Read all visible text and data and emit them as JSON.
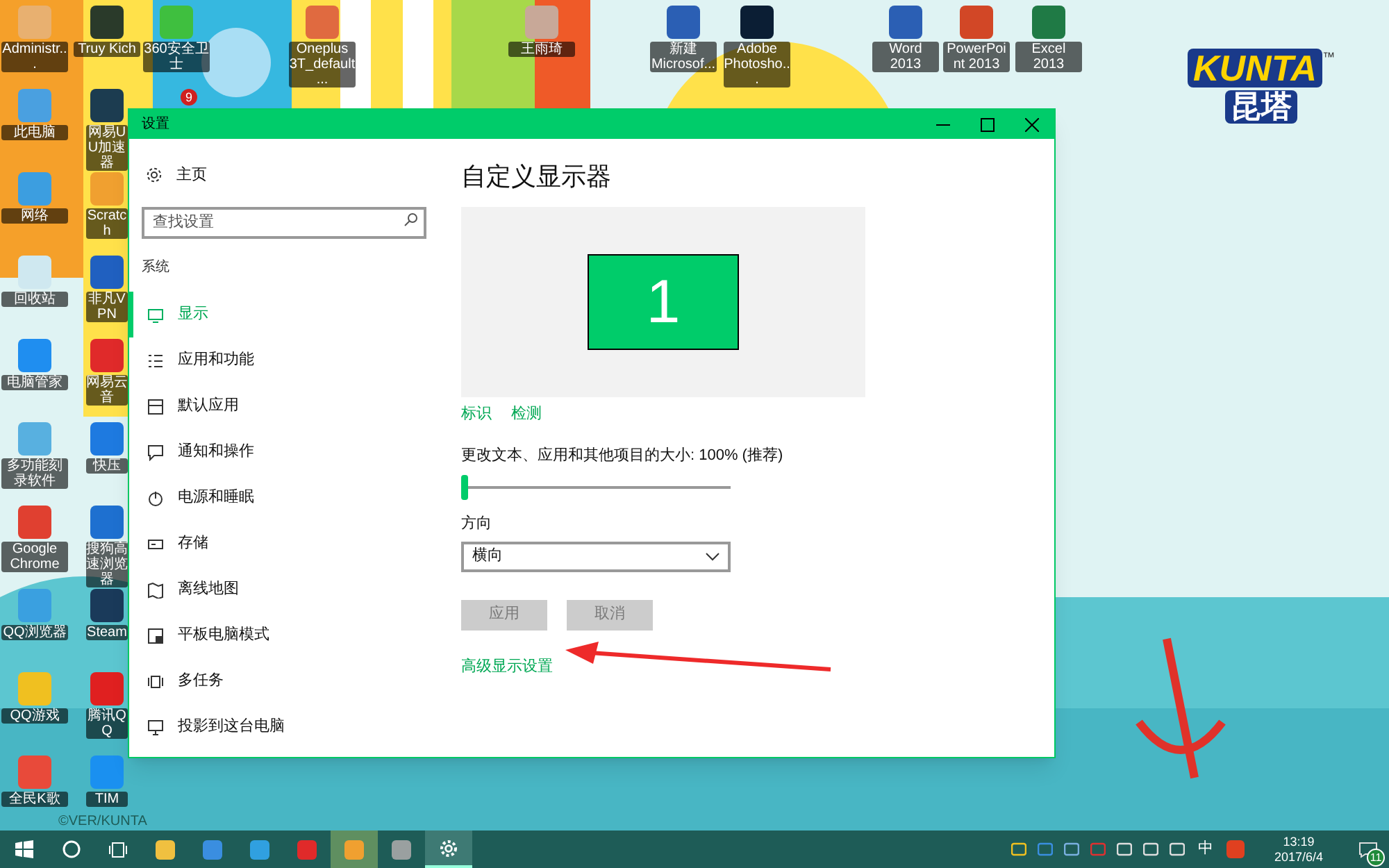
{
  "desktop": {
    "logo": {
      "text": "KUNTA",
      "subtitle": "昆塔",
      "mark": "™"
    },
    "credit": "©VER/KUNTA",
    "icons": [
      {
        "label": "Administr..."
      },
      {
        "label": "Truy Kich"
      },
      {
        "label": "360安全卫士"
      },
      {
        "label": "Oneplus 3T_default..."
      },
      {
        "label": "王雨琦"
      },
      {
        "label": "新建 Microsof..."
      },
      {
        "label": "Adobe Photosho..."
      },
      {
        "label": "Word 2013"
      },
      {
        "label": "PowerPoint 2013"
      },
      {
        "label": "Excel 2013"
      },
      {
        "label": "此电脑"
      },
      {
        "label": "网络"
      },
      {
        "label": "回收站"
      },
      {
        "label": "电脑管家"
      },
      {
        "label": "多功能刻录软件"
      },
      {
        "label": "Google Chrome"
      },
      {
        "label": "QQ浏览器"
      },
      {
        "label": "QQ游戏"
      },
      {
        "label": "全民K歌"
      },
      {
        "label": "网易UU加速器"
      },
      {
        "label": "Scratch"
      },
      {
        "label": "非凡VPN"
      },
      {
        "label": "网易云音"
      },
      {
        "label": "快压"
      },
      {
        "label": "搜狗高速浏览器"
      },
      {
        "label": "Steam"
      },
      {
        "label": "腾讯QQ"
      },
      {
        "label": "TIM"
      }
    ],
    "badge": "9"
  },
  "window": {
    "title": "设置",
    "sidebar": {
      "home": "主页",
      "search": {
        "placeholder": "查找设置"
      },
      "section": "系统",
      "items": [
        {
          "label": "显示",
          "selected": true
        },
        {
          "label": "应用和功能",
          "selected": false
        },
        {
          "label": "默认应用",
          "selected": false
        },
        {
          "label": "通知和操作",
          "selected": false
        },
        {
          "label": "电源和睡眠",
          "selected": false
        },
        {
          "label": "存储",
          "selected": false
        },
        {
          "label": "离线地图",
          "selected": false
        },
        {
          "label": "平板电脑模式",
          "selected": false
        },
        {
          "label": "多任务",
          "selected": false
        },
        {
          "label": "投影到这台电脑",
          "selected": false
        }
      ]
    },
    "content": {
      "heading": "自定义显示器",
      "monitor": "1",
      "links": [
        "标识",
        "检测"
      ],
      "scale": {
        "label": "更改文本、应用和其他项目的大小: 100% (推荐)",
        "level": 0
      },
      "orientation": {
        "label": "方向",
        "value": "横向"
      },
      "buttons": [
        {
          "label": "应用",
          "disabled": true
        },
        {
          "label": "取消",
          "disabled": true
        }
      ],
      "advanced_link": "高级显示设置"
    }
  },
  "taskbar": {
    "ime": "中",
    "time": "13:19",
    "date": "2017/6/4",
    "notifications": "11"
  }
}
